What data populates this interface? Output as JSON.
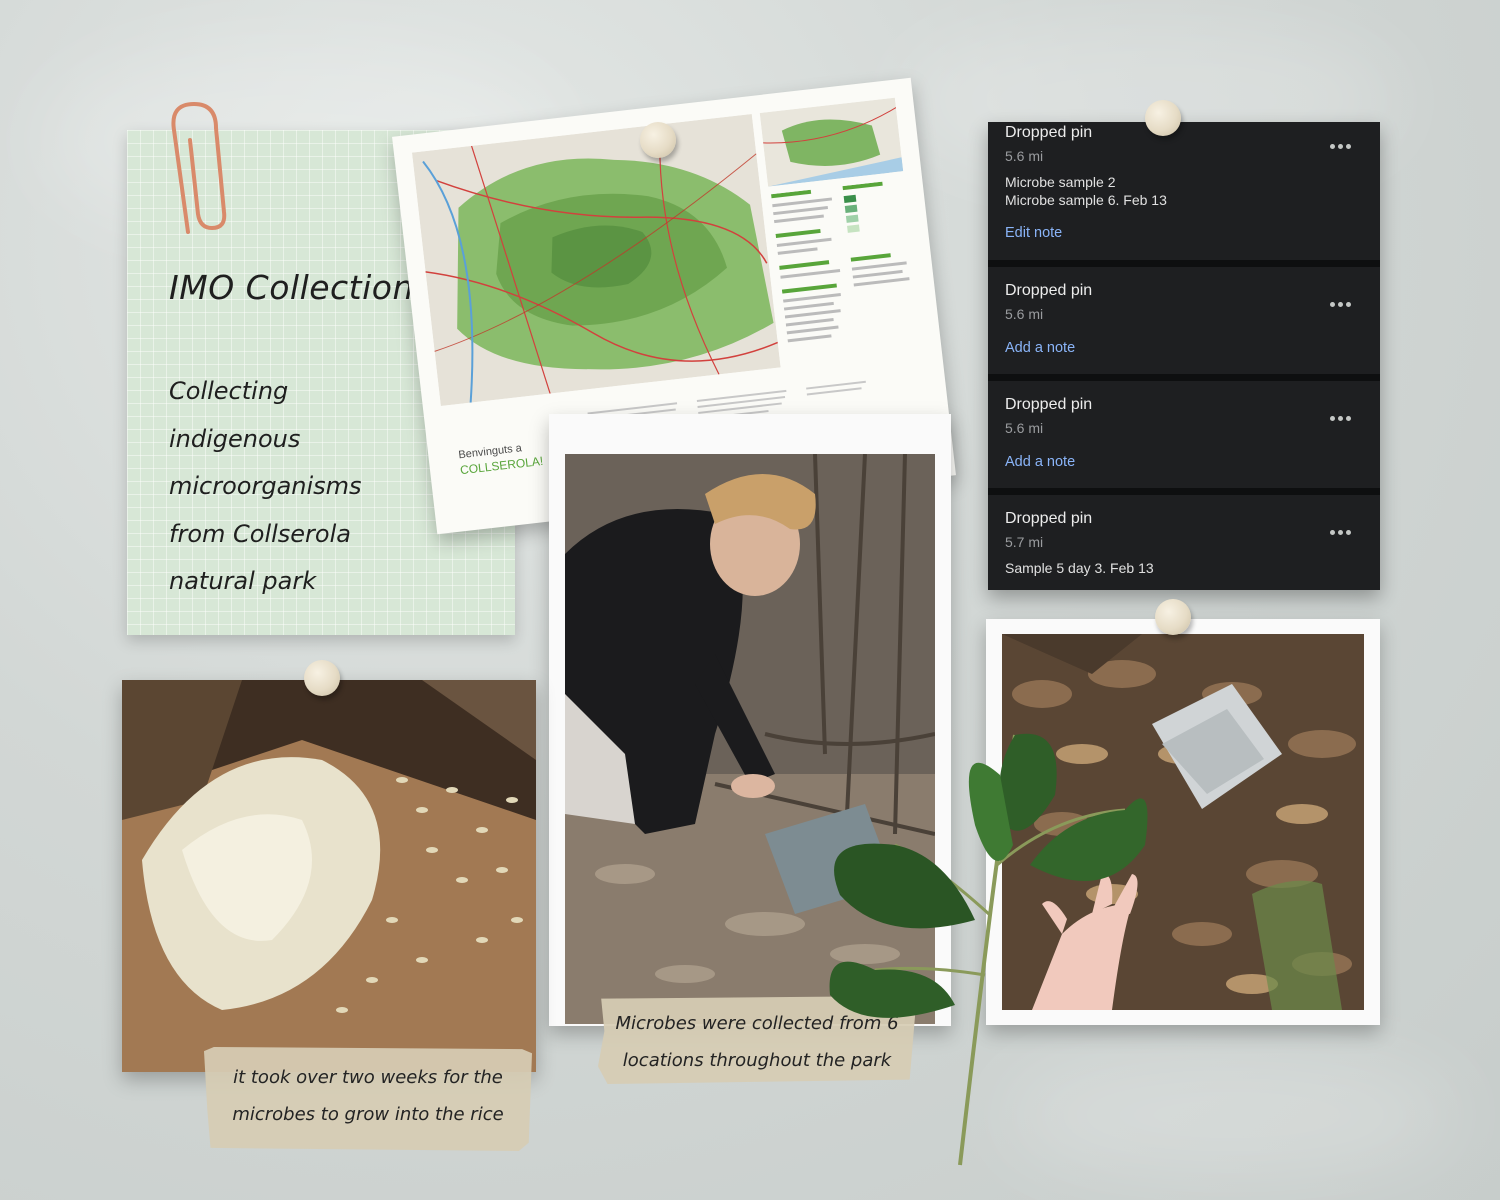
{
  "note": {
    "title": "IMO Collection",
    "body_lines": [
      "Collecting",
      "indigenous",
      "microorganisms",
      "from Collserola",
      "natural park"
    ]
  },
  "map_print": {
    "welcome": "Benvinguts a",
    "brand": "COLLSEROLA!"
  },
  "pins_panel": {
    "cards": [
      {
        "title": "Dropped pin",
        "distance": "5.6 mi",
        "notes": [
          "Microbe sample 2",
          "Microbe sample 6. Feb 13"
        ],
        "link": "Edit note"
      },
      {
        "title": "Dropped pin",
        "distance": "5.6 mi",
        "notes": [],
        "link": "Add a note"
      },
      {
        "title": "Dropped pin",
        "distance": "5.6 mi",
        "notes": [],
        "link": "Add a note"
      },
      {
        "title": "Dropped pin",
        "distance": "5.7 mi",
        "notes": [
          "Sample 5 day 3. Feb 13"
        ],
        "link": ""
      }
    ]
  },
  "captions": {
    "rice": [
      "it took over two weeks for the",
      "microbes to grow into the rice"
    ],
    "woman": [
      "Microbes were collected from 6",
      "locations throughout the park"
    ]
  },
  "colors": {
    "note_bg": "#d7e7d6",
    "panel_bg": "#1e1f21",
    "link_blue": "#8ab4f8",
    "tape": "#d6ccb4",
    "brand_green": "#58a53a"
  }
}
